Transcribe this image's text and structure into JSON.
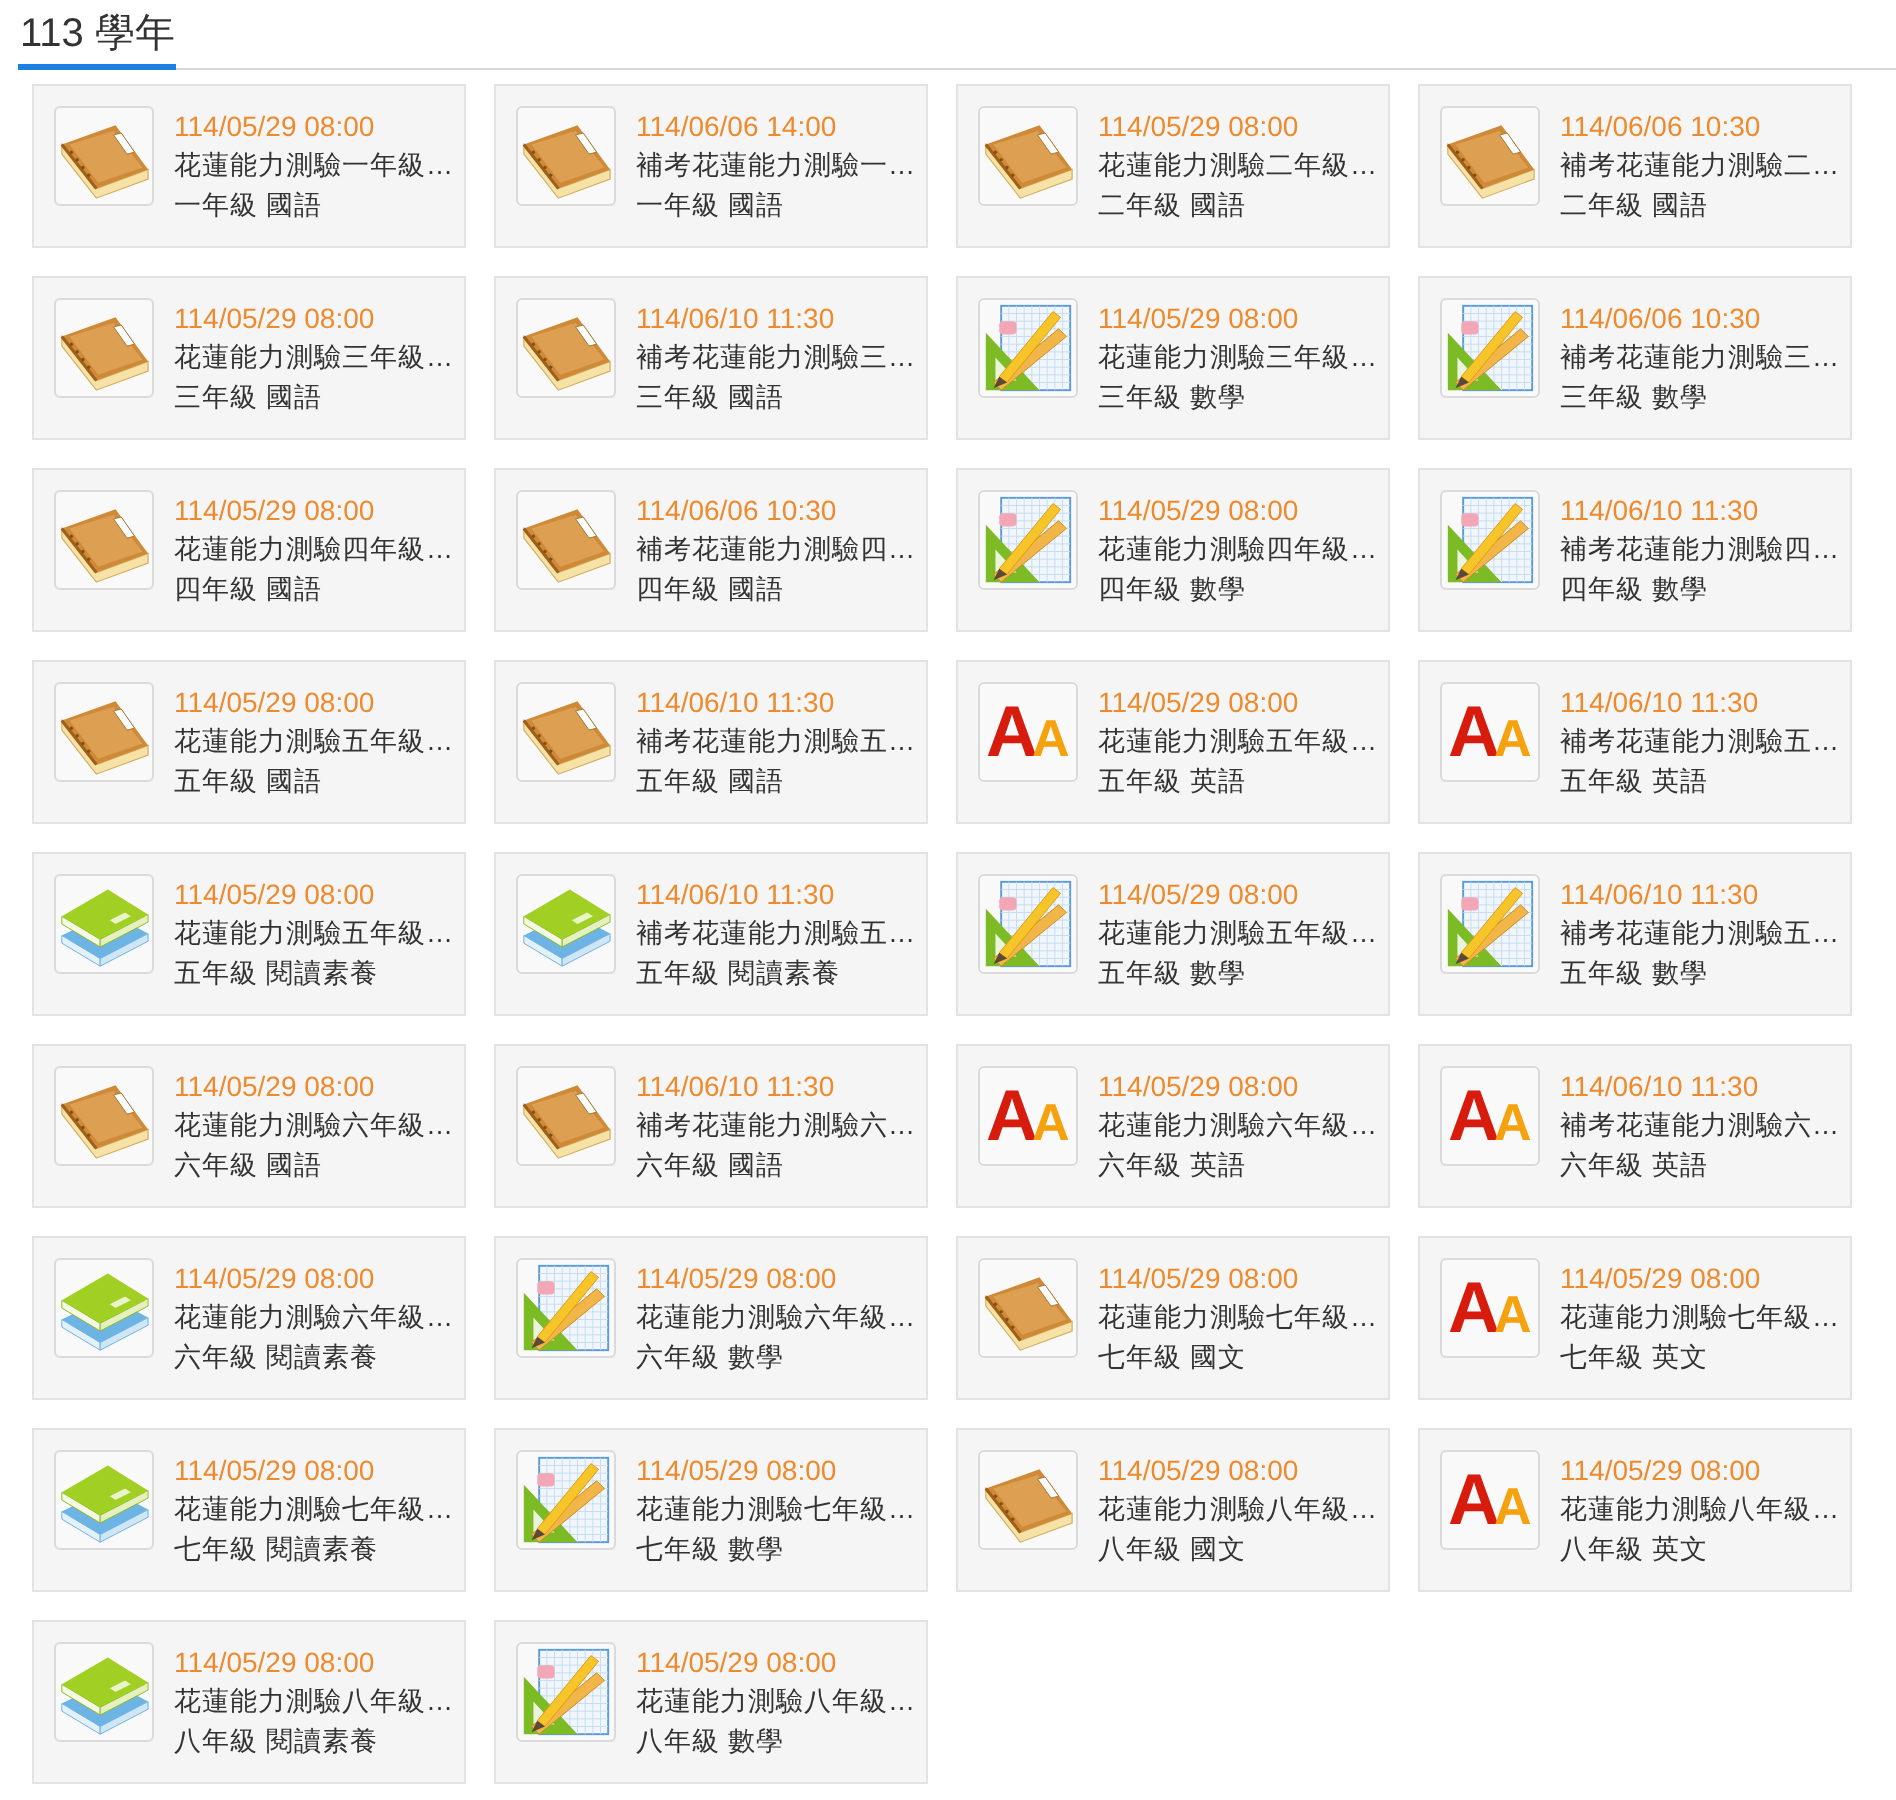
{
  "year_tab": {
    "label": "113 學年",
    "selected": true
  },
  "exams": [
    {
      "kind": "book",
      "date": "114/05/29 08:00",
      "title": "花蓮能力測驗一年級…",
      "subject": "一年級 國語"
    },
    {
      "kind": "book",
      "date": "114/06/06 14:00",
      "title": "補考花蓮能力測驗一…",
      "subject": "一年級 國語"
    },
    {
      "kind": "book",
      "date": "114/05/29 08:00",
      "title": "花蓮能力測驗二年級…",
      "subject": "二年級 國語"
    },
    {
      "kind": "book",
      "date": "114/06/06 10:30",
      "title": "補考花蓮能力測驗二…",
      "subject": "二年級 國語"
    },
    {
      "kind": "book",
      "date": "114/05/29 08:00",
      "title": "花蓮能力測驗三年級…",
      "subject": "三年級 國語"
    },
    {
      "kind": "book",
      "date": "114/06/10 11:30",
      "title": "補考花蓮能力測驗三…",
      "subject": "三年級 國語"
    },
    {
      "kind": "math",
      "date": "114/05/29 08:00",
      "title": "花蓮能力測驗三年級…",
      "subject": "三年級 數學"
    },
    {
      "kind": "math",
      "date": "114/06/06 10:30",
      "title": "補考花蓮能力測驗三…",
      "subject": "三年級 數學"
    },
    {
      "kind": "book",
      "date": "114/05/29 08:00",
      "title": "花蓮能力測驗四年級…",
      "subject": "四年級 國語"
    },
    {
      "kind": "book",
      "date": "114/06/06 10:30",
      "title": "補考花蓮能力測驗四…",
      "subject": "四年級 國語"
    },
    {
      "kind": "math",
      "date": "114/05/29 08:00",
      "title": "花蓮能力測驗四年級…",
      "subject": "四年級 數學"
    },
    {
      "kind": "math",
      "date": "114/06/10 11:30",
      "title": "補考花蓮能力測驗四…",
      "subject": "四年級 數學"
    },
    {
      "kind": "book",
      "date": "114/05/29 08:00",
      "title": "花蓮能力測驗五年級…",
      "subject": "五年級 國語"
    },
    {
      "kind": "book",
      "date": "114/06/10 11:30",
      "title": "補考花蓮能力測驗五…",
      "subject": "五年級 國語"
    },
    {
      "kind": "letters",
      "icon_text": "AA",
      "date": "114/05/29 08:00",
      "title": "花蓮能力測驗五年級…",
      "subject": "五年級 英語"
    },
    {
      "kind": "letters",
      "icon_text": "AA",
      "date": "114/06/10 11:30",
      "title": "補考花蓮能力測驗五…",
      "subject": "五年級 英語"
    },
    {
      "kind": "stacked-books",
      "date": "114/05/29 08:00",
      "title": "花蓮能力測驗五年級…",
      "subject": "五年級 閱讀素養"
    },
    {
      "kind": "stacked-books",
      "date": "114/06/10 11:30",
      "title": "補考花蓮能力測驗五…",
      "subject": "五年級 閱讀素養"
    },
    {
      "kind": "math",
      "date": "114/05/29 08:00",
      "title": "花蓮能力測驗五年級…",
      "subject": "五年級 數學"
    },
    {
      "kind": "math",
      "date": "114/06/10 11:30",
      "title": "補考花蓮能力測驗五…",
      "subject": "五年級 數學"
    },
    {
      "kind": "book",
      "date": "114/05/29 08:00",
      "title": "花蓮能力測驗六年級…",
      "subject": "六年級 國語"
    },
    {
      "kind": "book",
      "date": "114/06/10 11:30",
      "title": "補考花蓮能力測驗六…",
      "subject": "六年級 國語"
    },
    {
      "kind": "letters",
      "icon_text": "AA",
      "date": "114/05/29 08:00",
      "title": "花蓮能力測驗六年級…",
      "subject": "六年級 英語"
    },
    {
      "kind": "letters",
      "icon_text": "AA",
      "date": "114/06/10 11:30",
      "title": "補考花蓮能力測驗六…",
      "subject": "六年級 英語"
    },
    {
      "kind": "stacked-books",
      "date": "114/05/29 08:00",
      "title": "花蓮能力測驗六年級…",
      "subject": "六年級 閱讀素養"
    },
    {
      "kind": "math",
      "date": "114/05/29 08:00",
      "title": "花蓮能力測驗六年級…",
      "subject": "六年級 數學"
    },
    {
      "kind": "book",
      "date": "114/05/29 08:00",
      "title": "花蓮能力測驗七年級…",
      "subject": "七年級 國文"
    },
    {
      "kind": "letters",
      "icon_text": "AA",
      "date": "114/05/29 08:00",
      "title": "花蓮能力測驗七年級…",
      "subject": "七年級 英文"
    },
    {
      "kind": "stacked-books",
      "date": "114/05/29 08:00",
      "title": "花蓮能力測驗七年級…",
      "subject": "七年級 閱讀素養"
    },
    {
      "kind": "math",
      "date": "114/05/29 08:00",
      "title": "花蓮能力測驗七年級…",
      "subject": "七年級 數學"
    },
    {
      "kind": "book",
      "date": "114/05/29 08:00",
      "title": "花蓮能力測驗八年級…",
      "subject": "八年級 國文"
    },
    {
      "kind": "letters",
      "icon_text": "AA",
      "date": "114/05/29 08:00",
      "title": "花蓮能力測驗八年級…",
      "subject": "八年級 英文"
    },
    {
      "kind": "stacked-books",
      "date": "114/05/29 08:00",
      "title": "花蓮能力測驗八年級…",
      "subject": "八年級 閱讀素養"
    },
    {
      "kind": "math",
      "date": "114/05/29 08:00",
      "title": "花蓮能力測驗八年級…",
      "subject": "八年級 數學"
    }
  ]
}
